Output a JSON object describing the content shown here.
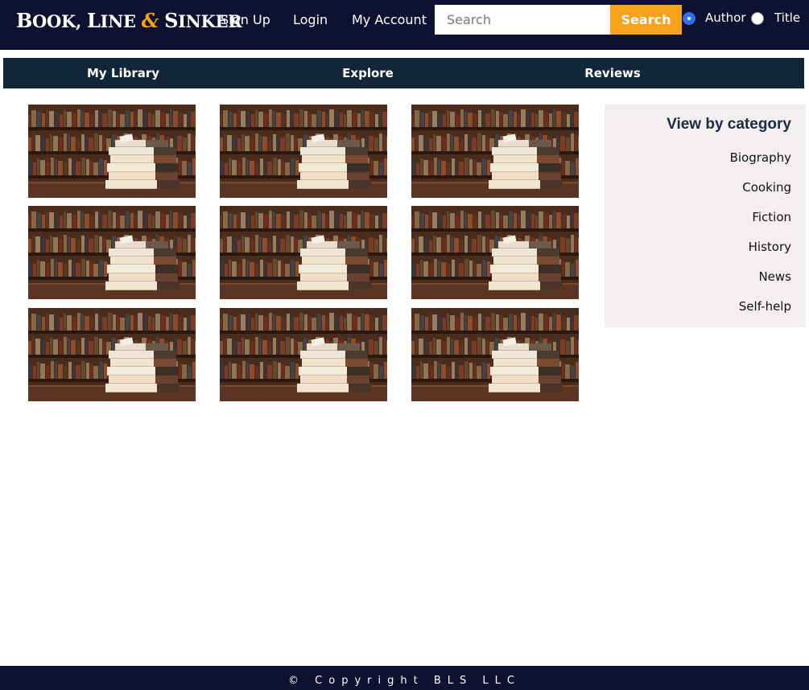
{
  "header": {
    "logo": {
      "w1": "B",
      "w1_rest": "OOK,",
      "w2": "L",
      "w2_rest": "INE",
      "amp": "&",
      "w3": "S",
      "w3_rest": "INKER"
    },
    "nav": {
      "sign_up": "Sign Up",
      "login": "Login",
      "my_account": "My Account"
    },
    "search": {
      "placeholder": "Search",
      "value": "",
      "button_label": "Search"
    },
    "search_by": {
      "options": [
        {
          "label": "Author",
          "selected": true
        },
        {
          "label": "Title",
          "selected": false
        }
      ]
    },
    "colors": {
      "background": "#0f1130",
      "accent": "#f7a21b"
    }
  },
  "tabs": [
    {
      "label": "My Library"
    },
    {
      "label": "Explore"
    },
    {
      "label": "Reviews"
    }
  ],
  "gallery": {
    "items": [
      {
        "icon": "book-stack-image"
      },
      {
        "icon": "book-stack-image"
      },
      {
        "icon": "book-stack-image"
      },
      {
        "icon": "book-stack-image"
      },
      {
        "icon": "book-stack-image"
      },
      {
        "icon": "book-stack-image"
      },
      {
        "icon": "book-stack-image"
      },
      {
        "icon": "book-stack-image"
      },
      {
        "icon": "book-stack-image"
      }
    ]
  },
  "sidebar": {
    "title": "View by category",
    "categories": [
      "Biography",
      "Cooking",
      "Fiction",
      "History",
      "News",
      "Self-help"
    ],
    "background": "#f3efef"
  },
  "footer": {
    "copyright": "© Copyright BLS LLC"
  }
}
